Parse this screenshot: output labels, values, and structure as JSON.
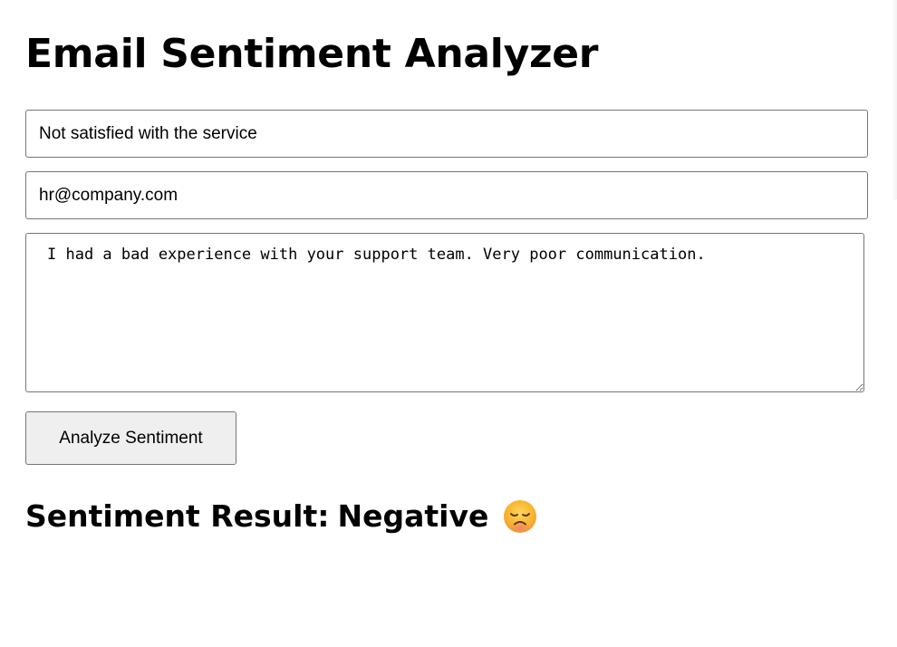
{
  "page": {
    "title": "Email Sentiment Analyzer"
  },
  "form": {
    "subject_value": "Not satisfied with the service",
    "email_value": "hr@company.com",
    "body_value": "I had a bad experience with your support team. Very poor communication.",
    "analyze_label": "Analyze Sentiment"
  },
  "result": {
    "label": "Sentiment Result:",
    "value": "Negative",
    "icon": "disappointed-face-emoji",
    "icon_color": "#F7B32B"
  }
}
